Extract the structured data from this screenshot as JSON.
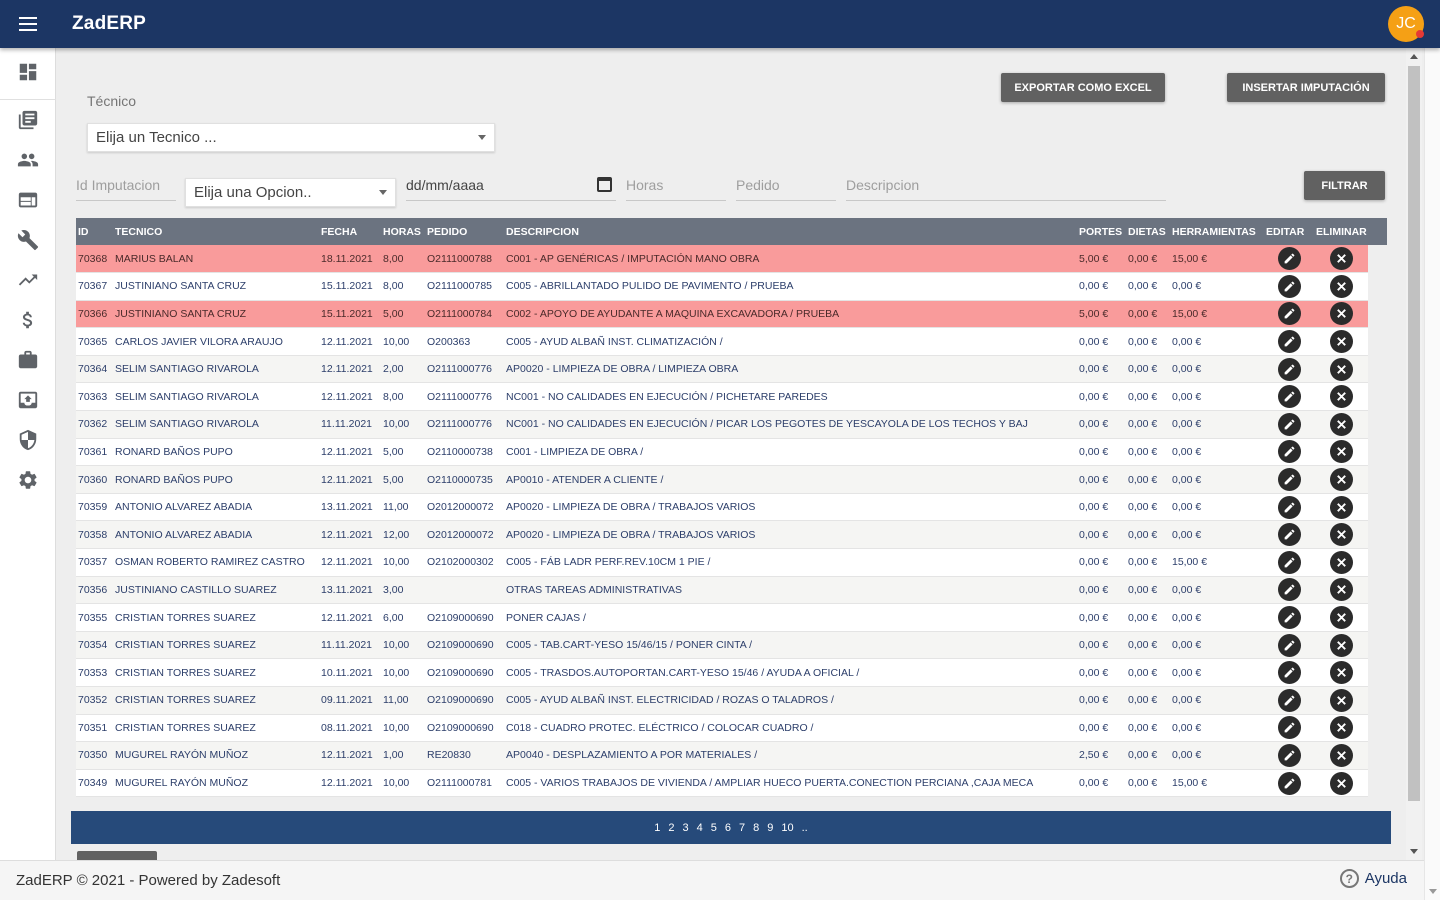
{
  "app": {
    "title": "ZadERP",
    "avatar_initials": "JC"
  },
  "sidebar": {
    "items": [
      {
        "icon": "dashboard-icon"
      },
      {
        "icon": "library-icon"
      },
      {
        "icon": "people-icon"
      },
      {
        "icon": "web-icon"
      },
      {
        "icon": "wrench-icon"
      },
      {
        "icon": "trending-up-icon"
      },
      {
        "icon": "dollar-icon"
      },
      {
        "icon": "briefcase-icon"
      },
      {
        "icon": "archive-upload-icon"
      },
      {
        "icon": "shield-icon"
      },
      {
        "icon": "gear-icon"
      }
    ]
  },
  "toolbar": {
    "export_label": "EXPORTAR COMO EXCEL",
    "insert_label": "INSERTAR IMPUTACIÓN",
    "filter_label": "FILTRAR"
  },
  "filters": {
    "tecnico_label": "Técnico",
    "tecnico_placeholder": "Elija un Tecnico ...",
    "id_placeholder": "Id Imputacion",
    "opcion_placeholder": "Elija una Opcion..",
    "date_placeholder": "dd/mm/aaaa",
    "horas_placeholder": "Horas",
    "pedido_placeholder": "Pedido",
    "descripcion_placeholder": "Descripcion"
  },
  "table": {
    "headers": [
      "ID",
      "TECNICO",
      "FECHA",
      "HORAS",
      "PEDIDO",
      "DESCRIPCION",
      "PORTES",
      "DIETAS",
      "HERRAMIENTAS",
      "EDITAR",
      "ELIMINAR"
    ],
    "rows": [
      {
        "id": "70368",
        "tecnico": "MARIUS BALAN",
        "fecha": "18.11.2021",
        "horas": "8,00",
        "pedido": "O2111000788",
        "descripcion": "C001 - AP GENÉRICAS / IMPUTACIÓN MANO OBRA",
        "portes": "5,00 €",
        "dietas": "0,00 €",
        "herramientas": "15,00 €",
        "highlight": true
      },
      {
        "id": "70367",
        "tecnico": "JUSTINIANO SANTA CRUZ",
        "fecha": "15.11.2021",
        "horas": "8,00",
        "pedido": "O2111000785",
        "descripcion": "C005 - ABRILLANTADO PULIDO DE PAVIMENTO / PRUEBA",
        "portes": "0,00 €",
        "dietas": "0,00 €",
        "herramientas": "0,00 €",
        "highlight": false
      },
      {
        "id": "70366",
        "tecnico": "JUSTINIANO SANTA CRUZ",
        "fecha": "15.11.2021",
        "horas": "5,00",
        "pedido": "O2111000784",
        "descripcion": "C002 - APOYO DE AYUDANTE A MAQUINA EXCAVADORA / PRUEBA",
        "portes": "5,00 €",
        "dietas": "0,00 €",
        "herramientas": "15,00 €",
        "highlight": true
      },
      {
        "id": "70365",
        "tecnico": "CARLOS JAVIER VILORA ARAUJO",
        "fecha": "12.11.2021",
        "horas": "10,00",
        "pedido": "O200363",
        "descripcion": "C005 - AYUD ALBAÑ INST. CLIMATIZACIÓN /",
        "portes": "0,00 €",
        "dietas": "0,00 €",
        "herramientas": "0,00 €",
        "highlight": false
      },
      {
        "id": "70364",
        "tecnico": "SELIM SANTIAGO RIVAROLA",
        "fecha": "12.11.2021",
        "horas": "2,00",
        "pedido": "O2111000776",
        "descripcion": "AP0020 - LIMPIEZA DE OBRA / LIMPIEZA OBRA",
        "portes": "0,00 €",
        "dietas": "0,00 €",
        "herramientas": "0,00 €",
        "highlight": false
      },
      {
        "id": "70363",
        "tecnico": "SELIM SANTIAGO RIVAROLA",
        "fecha": "12.11.2021",
        "horas": "8,00",
        "pedido": "O2111000776",
        "descripcion": "NC001 - NO CALIDADES EN EJECUCIÓN / PICHETARE PAREDES",
        "portes": "0,00 €",
        "dietas": "0,00 €",
        "herramientas": "0,00 €",
        "highlight": false
      },
      {
        "id": "70362",
        "tecnico": "SELIM SANTIAGO RIVAROLA",
        "fecha": "11.11.2021",
        "horas": "10,00",
        "pedido": "O2111000776",
        "descripcion": "NC001 - NO CALIDADES EN EJECUCIÓN / PICAR LOS PEGOTES DE YESCAYOLA DE LOS TECHOS Y BAJ",
        "portes": "0,00 €",
        "dietas": "0,00 €",
        "herramientas": "0,00 €",
        "highlight": false
      },
      {
        "id": "70361",
        "tecnico": "RONARD BAÑOS PUPO",
        "fecha": "12.11.2021",
        "horas": "5,00",
        "pedido": "O2110000738",
        "descripcion": "C001 - LIMPIEZA DE OBRA /",
        "portes": "0,00 €",
        "dietas": "0,00 €",
        "herramientas": "0,00 €",
        "highlight": false
      },
      {
        "id": "70360",
        "tecnico": "RONARD BAÑOS PUPO",
        "fecha": "12.11.2021",
        "horas": "5,00",
        "pedido": "O2110000735",
        "descripcion": "AP0010 - ATENDER A CLIENTE /",
        "portes": "0,00 €",
        "dietas": "0,00 €",
        "herramientas": "0,00 €",
        "highlight": false
      },
      {
        "id": "70359",
        "tecnico": "ANTONIO ALVAREZ ABADIA",
        "fecha": "13.11.2021",
        "horas": "11,00",
        "pedido": "O2012000072",
        "descripcion": "AP0020 - LIMPIEZA DE OBRA / TRABAJOS VARIOS",
        "portes": "0,00 €",
        "dietas": "0,00 €",
        "herramientas": "0,00 €",
        "highlight": false
      },
      {
        "id": "70358",
        "tecnico": "ANTONIO ALVAREZ ABADIA",
        "fecha": "12.11.2021",
        "horas": "12,00",
        "pedido": "O2012000072",
        "descripcion": "AP0020 - LIMPIEZA DE OBRA / TRABAJOS VARIOS",
        "portes": "0,00 €",
        "dietas": "0,00 €",
        "herramientas": "0,00 €",
        "highlight": false
      },
      {
        "id": "70357",
        "tecnico": "OSMAN ROBERTO RAMIREZ CASTRO",
        "fecha": "12.11.2021",
        "horas": "10,00",
        "pedido": "O2102000302",
        "descripcion": "C005 - FÁB LADR PERF.REV.10CM 1 PIE /",
        "portes": "0,00 €",
        "dietas": "0,00 €",
        "herramientas": "15,00 €",
        "highlight": false
      },
      {
        "id": "70356",
        "tecnico": "JUSTINIANO CASTILLO SUAREZ",
        "fecha": "13.11.2021",
        "horas": "3,00",
        "pedido": "",
        "descripcion": "OTRAS TAREAS ADMINISTRATIVAS",
        "portes": "0,00 €",
        "dietas": "0,00 €",
        "herramientas": "0,00 €",
        "highlight": false
      },
      {
        "id": "70355",
        "tecnico": "CRISTIAN TORRES SUAREZ",
        "fecha": "12.11.2021",
        "horas": "6,00",
        "pedido": "O2109000690",
        "descripcion": "PONER CAJAS /",
        "portes": "0,00 €",
        "dietas": "0,00 €",
        "herramientas": "0,00 €",
        "highlight": false
      },
      {
        "id": "70354",
        "tecnico": "CRISTIAN TORRES SUAREZ",
        "fecha": "11.11.2021",
        "horas": "10,00",
        "pedido": "O2109000690",
        "descripcion": "C005 - TAB.CART-YESO 15/46/15 / PONER CINTA /",
        "portes": "0,00 €",
        "dietas": "0,00 €",
        "herramientas": "0,00 €",
        "highlight": false
      },
      {
        "id": "70353",
        "tecnico": "CRISTIAN TORRES SUAREZ",
        "fecha": "10.11.2021",
        "horas": "10,00",
        "pedido": "O2109000690",
        "descripcion": "C005 - TRASDOS.AUTOPORTAN.CART-YESO 15/46 / AYUDA A OFICIAL /",
        "portes": "0,00 €",
        "dietas": "0,00 €",
        "herramientas": "0,00 €",
        "highlight": false
      },
      {
        "id": "70352",
        "tecnico": "CRISTIAN TORRES SUAREZ",
        "fecha": "09.11.2021",
        "horas": "11,00",
        "pedido": "O2109000690",
        "descripcion": "C005 - AYUD ALBAÑ INST. ELECTRICIDAD / ROZAS O TALADROS /",
        "portes": "0,00 €",
        "dietas": "0,00 €",
        "herramientas": "0,00 €",
        "highlight": false
      },
      {
        "id": "70351",
        "tecnico": "CRISTIAN TORRES SUAREZ",
        "fecha": "08.11.2021",
        "horas": "10,00",
        "pedido": "O2109000690",
        "descripcion": "C018 - CUADRO PROTEC. ELÉCTRICO / COLOCAR CUADRO /",
        "portes": "0,00 €",
        "dietas": "0,00 €",
        "herramientas": "0,00 €",
        "highlight": false
      },
      {
        "id": "70350",
        "tecnico": "MUGUREL RAYÓN MUÑOZ",
        "fecha": "12.11.2021",
        "horas": "1,00",
        "pedido": "RE20830",
        "descripcion": "AP0040 - DESPLAZAMIENTO A POR MATERIALES /",
        "portes": "2,50 €",
        "dietas": "0,00 €",
        "herramientas": "0,00 €",
        "highlight": false
      },
      {
        "id": "70349",
        "tecnico": "MUGUREL RAYÓN MUÑOZ",
        "fecha": "12.11.2021",
        "horas": "10,00",
        "pedido": "O2111000781",
        "descripcion": "C005 - VARIOS TRABAJOS DE VIVIENDA / AMPLIAR HUECO PUERTA.CONECTION PERCIANA ,CAJA MECA",
        "portes": "0,00 €",
        "dietas": "0,00 €",
        "herramientas": "15,00 €",
        "highlight": false
      }
    ]
  },
  "pagination": {
    "pages": [
      "1",
      "2",
      "3",
      "4",
      "5",
      "6",
      "7",
      "8",
      "9",
      "10",
      ".."
    ]
  },
  "footer": {
    "copyright": "ZadERP © 2021 - Powered by Zadesoft",
    "help_label": "Ayuda"
  },
  "colors": {
    "primary": "#1c3664",
    "highlight_row": "#f99b9b",
    "avatar": "#f5a015"
  }
}
